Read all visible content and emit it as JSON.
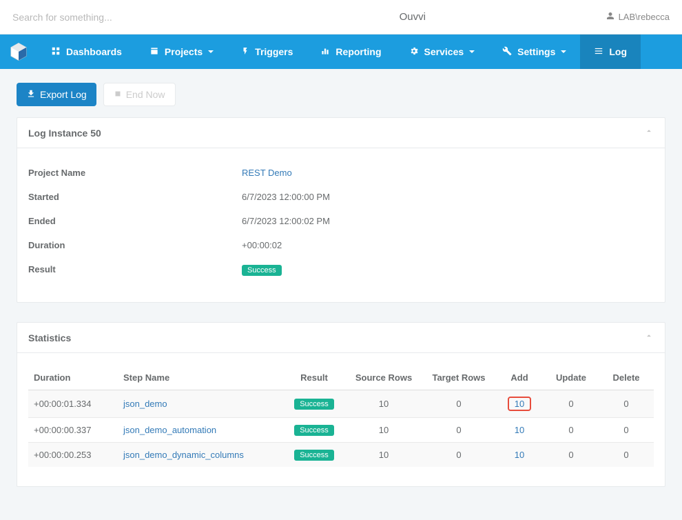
{
  "header": {
    "search_placeholder": "Search for something...",
    "brand": "Ouvvi",
    "user": "LAB\\rebecca"
  },
  "nav": {
    "items": [
      {
        "label": "Dashboards",
        "dropdown": false
      },
      {
        "label": "Projects",
        "dropdown": true
      },
      {
        "label": "Triggers",
        "dropdown": false
      },
      {
        "label": "Reporting",
        "dropdown": false
      },
      {
        "label": "Services",
        "dropdown": true
      },
      {
        "label": "Settings",
        "dropdown": true
      },
      {
        "label": "Log",
        "dropdown": false,
        "active": true
      }
    ]
  },
  "actions": {
    "export_log": "Export Log",
    "end_now": "End Now"
  },
  "log_panel": {
    "title": "Log Instance 50",
    "rows": {
      "project_name_label": "Project Name",
      "project_name_value": "REST Demo",
      "started_label": "Started",
      "started_value": "6/7/2023 12:00:00 PM",
      "ended_label": "Ended",
      "ended_value": "6/7/2023 12:00:02 PM",
      "duration_label": "Duration",
      "duration_value": "+00:00:02",
      "result_label": "Result",
      "result_value": "Success"
    }
  },
  "stats_panel": {
    "title": "Statistics",
    "columns": {
      "duration": "Duration",
      "step_name": "Step Name",
      "result": "Result",
      "source_rows": "Source Rows",
      "target_rows": "Target Rows",
      "add": "Add",
      "update": "Update",
      "delete": "Delete"
    },
    "rows": [
      {
        "duration": "+00:00:01.334",
        "step": "json_demo",
        "result": "Success",
        "source": "10",
        "target": "0",
        "add": "10",
        "update": "0",
        "delete": "0",
        "highlight_add": true
      },
      {
        "duration": "+00:00:00.337",
        "step": "json_demo_automation",
        "result": "Success",
        "source": "10",
        "target": "0",
        "add": "10",
        "update": "0",
        "delete": "0"
      },
      {
        "duration": "+00:00:00.253",
        "step": "json_demo_dynamic_columns",
        "result": "Success",
        "source": "10",
        "target": "0",
        "add": "10",
        "update": "0",
        "delete": "0"
      }
    ]
  }
}
